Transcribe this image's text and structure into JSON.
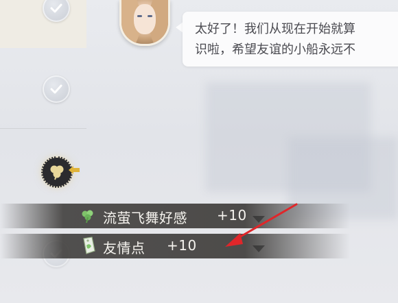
{
  "dialogue": {
    "line1": "太好了！我们从现在开始就算",
    "line2": "识啦，希望友谊的小船永远不"
  },
  "rewards": [
    {
      "name": "流萤飞舞好感",
      "amount": "+10",
      "icon": "clover-icon"
    },
    {
      "name": "友情点",
      "amount": "+10",
      "icon": "friendship-tag-icon"
    }
  ],
  "colors": {
    "bubble": "#fbfbfc",
    "text": "#4a4a50",
    "reward_bar": "#3c3a38",
    "annotation_arrow": "#e0262a",
    "clover_gold": "#e8d79a"
  },
  "icons": {
    "timeline_nodes": [
      "check-icon",
      "check-icon",
      "clover-icon",
      "check-icon"
    ],
    "node_pointer": "arrow-left-icon"
  }
}
